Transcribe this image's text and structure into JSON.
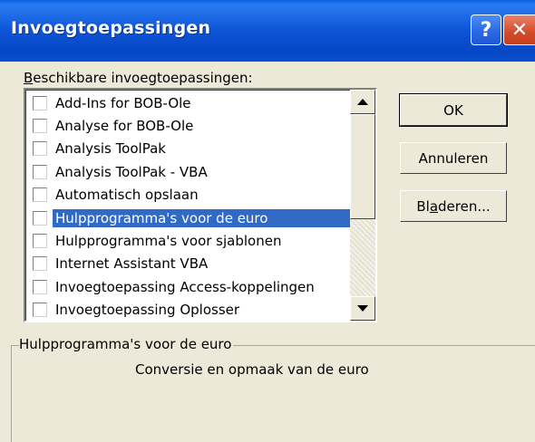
{
  "window": {
    "title": "Invoegtoepassingen",
    "help_glyph": "?",
    "close_glyph": "✕"
  },
  "list": {
    "label": "Beschikbare invoegtoepassingen:",
    "label_access_key": "B",
    "label_rest": "eschikbare invoegtoepassingen:",
    "items": [
      {
        "label": "Add-Ins for BOB-Ole",
        "checked": false
      },
      {
        "label": "Analyse for BOB-Ole",
        "checked": false
      },
      {
        "label": "Analysis ToolPak",
        "checked": false
      },
      {
        "label": "Analysis ToolPak - VBA",
        "checked": false
      },
      {
        "label": "Automatisch opslaan",
        "checked": false
      },
      {
        "label": "Hulpprogramma's voor de euro",
        "checked": false,
        "selected": true
      },
      {
        "label": "Hulpprogramma's voor sjablonen",
        "checked": false
      },
      {
        "label": "Internet Assistant VBA",
        "checked": false
      },
      {
        "label": "Invoegtoepassing Access-koppelingen",
        "checked": false
      },
      {
        "label": "Invoegtoepassing Oplosser",
        "checked": false
      }
    ]
  },
  "buttons": {
    "ok": "OK",
    "cancel": "Annuleren",
    "browse_prefix": "Bl",
    "browse_key": "a",
    "browse_suffix": "deren..."
  },
  "description": {
    "title": "Hulpprogramma's voor de euro",
    "text": "Conversie en opmaak van de euro"
  },
  "colors": {
    "titlebar": "#0A50D0",
    "selection": "#316AC5",
    "dialog_bg": "#ECE9D8",
    "close_button": "#D24B28"
  }
}
